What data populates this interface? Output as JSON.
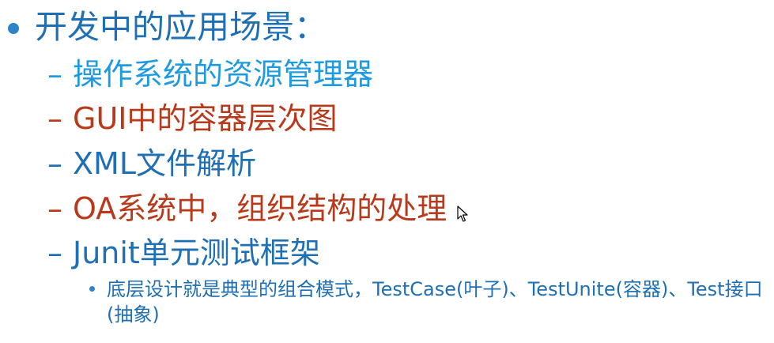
{
  "colors": {
    "dark_blue": "#1F6FB4",
    "light_blue": "#1E9BE0",
    "red": "#B83A1A",
    "bullet_blue": "#2D84C8"
  },
  "heading": "开发中的应用场景：",
  "items": [
    {
      "text": "操作系统的资源管理器",
      "color": "#1E9BE0"
    },
    {
      "text": "GUI中的容器层次图",
      "color": "#B83A1A"
    },
    {
      "text": "XML文件解析",
      "color": "#1F6FB4"
    },
    {
      "text": "OA系统中，组织结构的处理",
      "color": "#B83A1A"
    },
    {
      "text": "Junit单元测试框架",
      "color": "#1F6FB4"
    }
  ],
  "dash": "–",
  "sub_item": "底层设计就是典型的组合模式，TestCase(叶子)、TestUnite(容器)、Test接口(抽象)",
  "cursor_icon": "mouse-pointer-icon"
}
